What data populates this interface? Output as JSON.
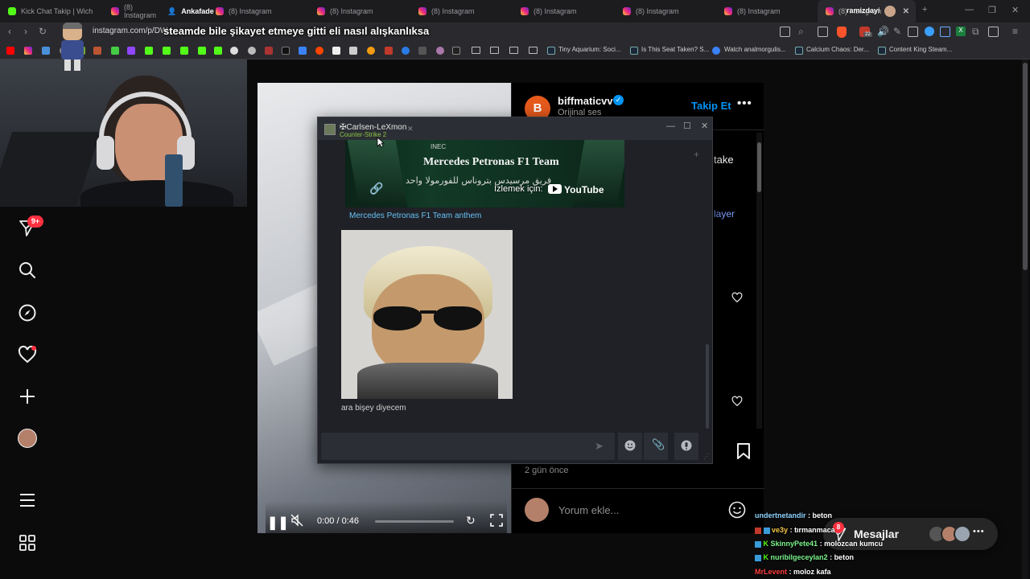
{
  "browser": {
    "tabs": [
      {
        "title": "Kick Chat Takip | Wich"
      },
      {
        "title": "(8) Instagram"
      },
      {
        "title": "Ankafade"
      },
      {
        "title": "(8) Instagram"
      },
      {
        "title": "(8) Instagram"
      },
      {
        "title": "(8) Instagram"
      },
      {
        "title": "(8) Instagram"
      },
      {
        "title": "(8) Instagram"
      },
      {
        "title": "(8) Instagram"
      },
      {
        "title": "(8) Instagram"
      }
    ],
    "active_tab_overlay": "ramizdayi",
    "url": "instagram.com/p/DW",
    "bookmarks": [
      {
        "label": "Tiny Aquarium: Soci..."
      },
      {
        "label": "Is This Seat Taken? S..."
      },
      {
        "label": "Watch analmorgulis..."
      },
      {
        "label": "Calcium Chaos: Der..."
      },
      {
        "label": "Content King Steam..."
      }
    ],
    "extension_badge": "22"
  },
  "stream_overlay": {
    "title": "steamde bile şikayet etmeye gitti eli nasıl alışkanlıksa"
  },
  "instagram": {
    "nav": {
      "notification_badge": "9+"
    },
    "post": {
      "username": "biffmaticvv",
      "audio": "Orijinal ses",
      "follow_label": "Takip Et",
      "caption_fragment": "take",
      "link_fragment": "layer",
      "time_ago": "2 gün önce",
      "comment_placeholder": "Yorum ekle..."
    },
    "video": {
      "time": "0:00 / 0:46"
    },
    "messages": {
      "label": "Mesajlar",
      "badge": "8"
    }
  },
  "steam_chat": {
    "contact_name": "✠Carlsen-LeXmon",
    "contact_status": "Counter-Strike 2",
    "youtube_card_title": "Mercedes Petronas F1 Team",
    "youtube_card_subtitle": "فريق مرسيدس بتروناس للفورمولا واحد",
    "youtube_watch_text": "İzlemek için:",
    "youtube_brand": "YouTube",
    "link_title": "Mercedes Petronas F1 Team anthem",
    "inec_text": "INEC",
    "message_text": "ara bişey diyecem"
  },
  "stream_chat": [
    {
      "user": "undertnetandir",
      "message": "beton",
      "color": "#8fd3ff"
    },
    {
      "user": "ve3y",
      "message": "tırmanmaca",
      "color": "#f5c542"
    },
    {
      "user": "SkinnyPete41",
      "message": "molozcan kumcu",
      "color": "#7cf28b"
    },
    {
      "user": "nuribilgeceylan2",
      "message": "beton",
      "color": "#7cf28b"
    },
    {
      "user": "MrLevent",
      "message": "moloz kafa",
      "color": "#ff3b3b"
    }
  ]
}
